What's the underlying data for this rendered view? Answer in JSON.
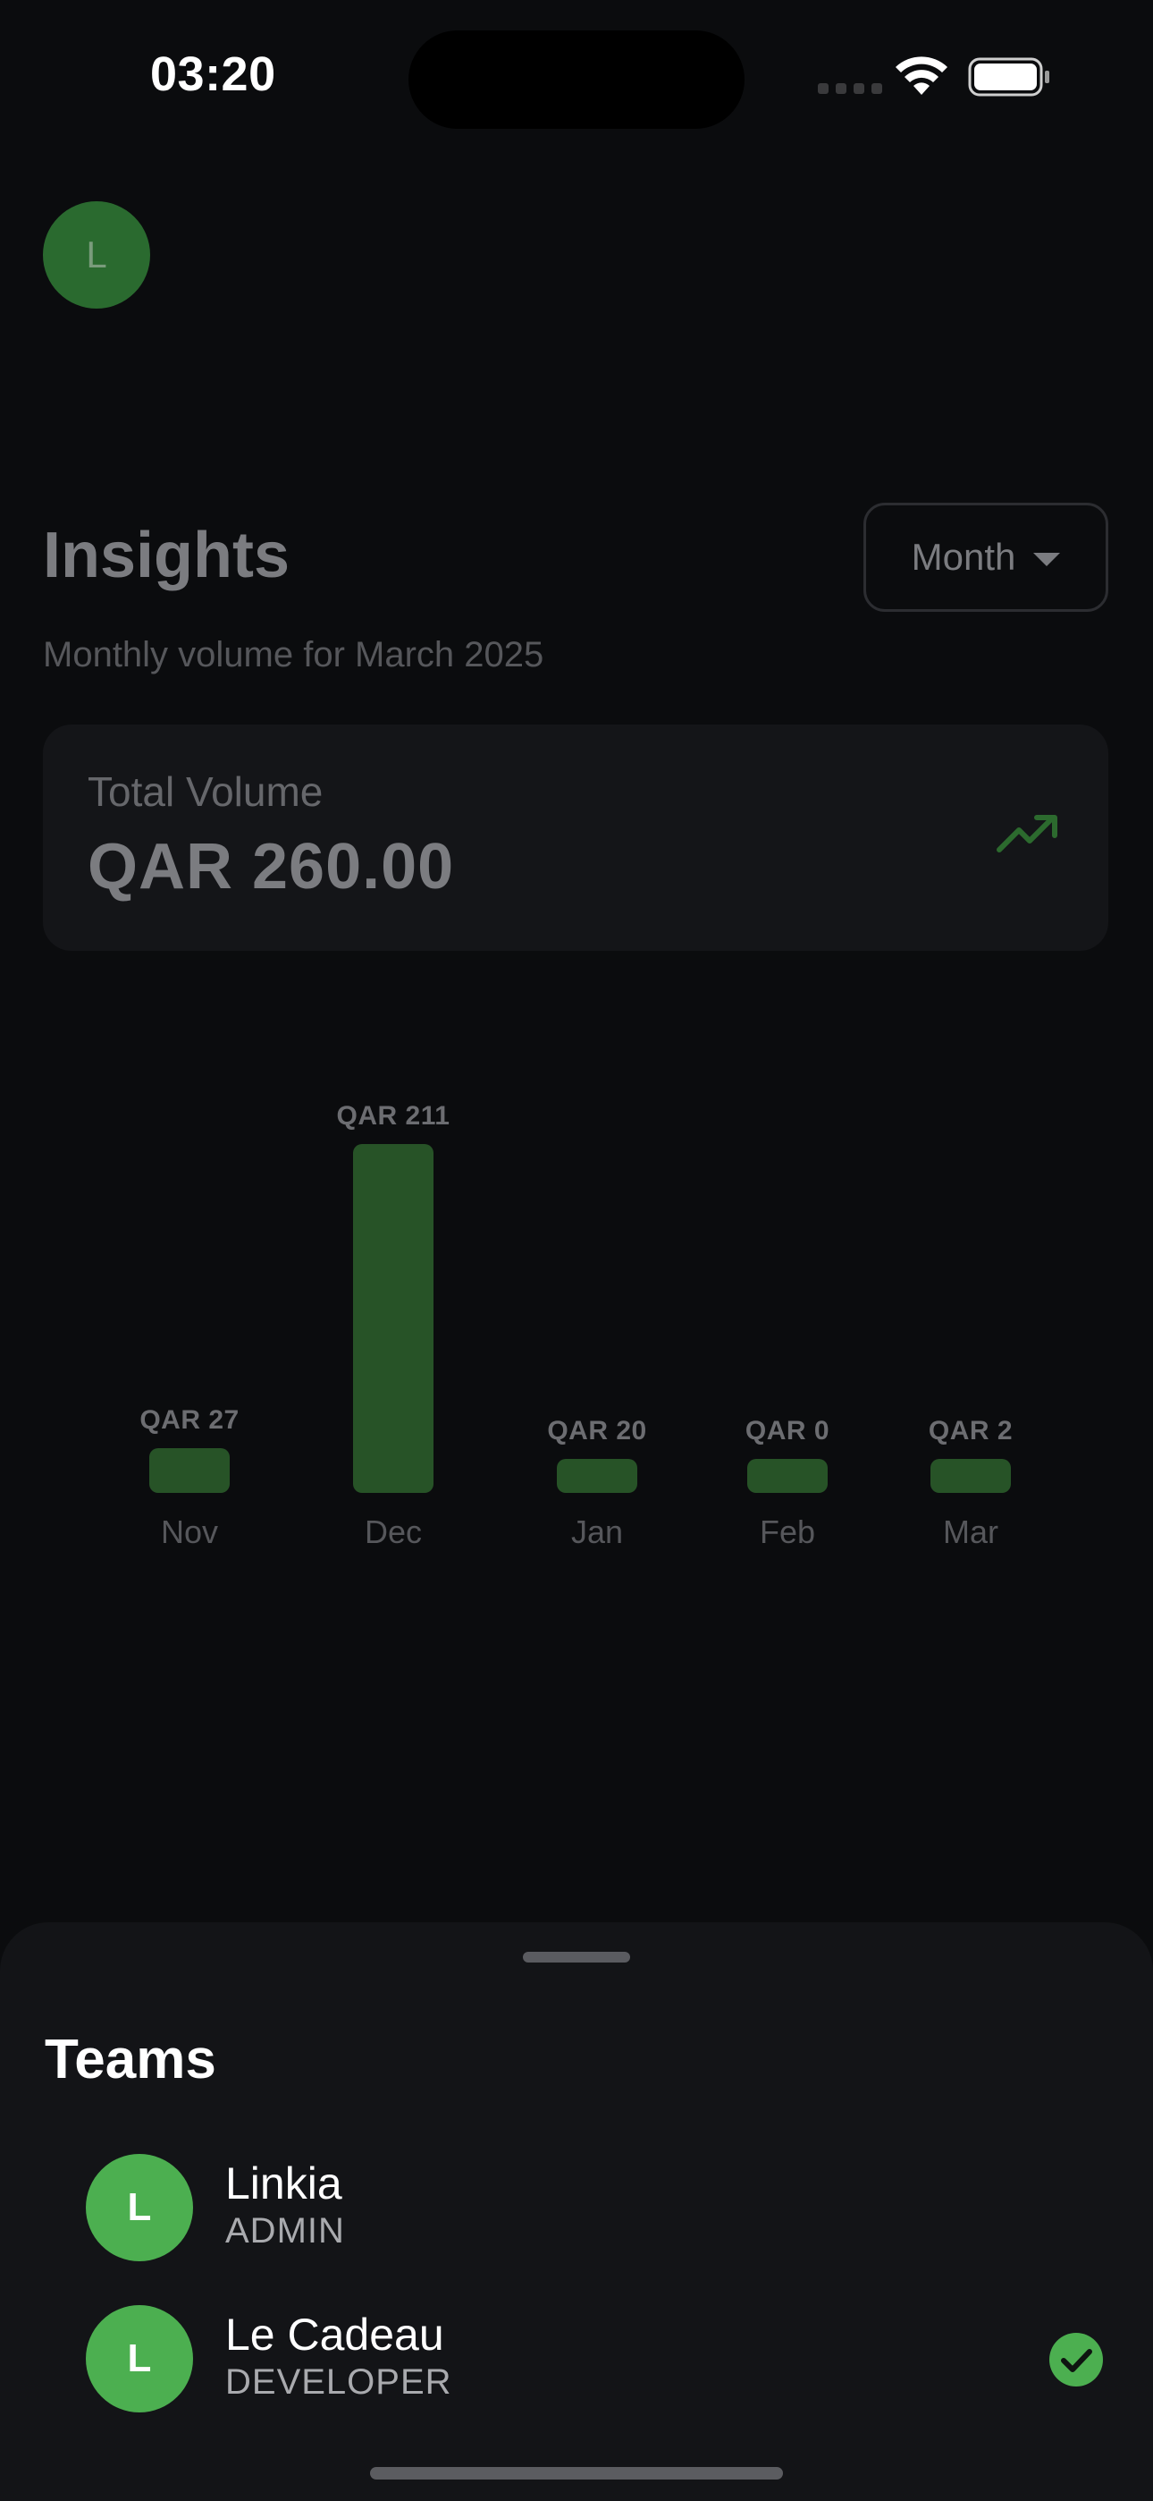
{
  "status_bar": {
    "time": "03:20"
  },
  "header": {
    "avatar_letter": "L"
  },
  "insights": {
    "title": "Insights",
    "subtitle": "Monthly volume for March 2025",
    "period_selected": "Month"
  },
  "total_volume": {
    "label": "Total Volume",
    "value": "QAR 260.00"
  },
  "chart_data": {
    "type": "bar",
    "categories": [
      "Nov",
      "Dec",
      "Jan",
      "Feb",
      "Mar"
    ],
    "values": [
      27,
      211,
      20,
      0,
      2
    ],
    "value_labels": [
      "QAR 27",
      "QAR 211",
      "QAR 20",
      "QAR 0",
      "QAR 2"
    ],
    "title": "",
    "xlabel": "",
    "ylabel": "",
    "grid": false,
    "bar_color": "#275327"
  },
  "sheet": {
    "title": "Teams",
    "teams": [
      {
        "letter": "L",
        "name": "Linkia",
        "role": "ADMIN",
        "selected": false
      },
      {
        "letter": "L",
        "name": "Le Cadeau",
        "role": "DEVELOPER",
        "selected": true
      }
    ]
  },
  "colors": {
    "accent_green": "#4caf50",
    "background": "#0b0c0e",
    "sheet_background": "#131417"
  }
}
